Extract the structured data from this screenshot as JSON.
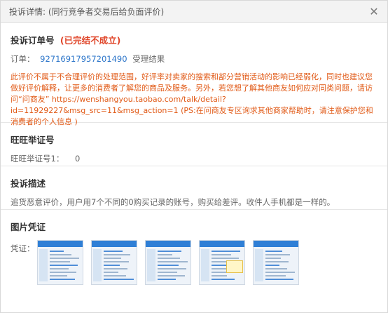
{
  "title": "投诉详情: (同行竞争者交易后给负面评价)",
  "order": {
    "heading": "投诉订单号",
    "status": "(已完结不成立)",
    "order_label": "订单：",
    "order_number": "92716917957201490",
    "result_label": "受理结果",
    "notice": "此评价不属于不合理评价的处理范围，好评率对卖家的搜索和部分营销活动的影响已经弱化，同时也建议您做好评价解释，让更多的消费者了解您的商品及服务。另外，若您想了解其他商友如何应对同类问题，请访问“问商友” https://wenshangyou.taobao.com/talk/detail?id=11929227&msg_src=11&msg_action=1 (PS:在问商友专区询求其他商家帮助时，请注意保护您和消费者的个人信息 )"
  },
  "wangwang": {
    "heading": "旺旺举证号",
    "label": "旺旺举证号1：",
    "value": "0"
  },
  "description": {
    "heading": "投诉描述",
    "text": "追货恶意评价，用户用7个不同的0购买记录的账号，购买给差评。收件人手机都是一样的。"
  },
  "images": {
    "heading": "图片凭证",
    "label": "凭证：",
    "count": 5
  },
  "colors": {
    "status": "#e0462a",
    "link": "#2a74c9",
    "notice": "#e15a17"
  }
}
